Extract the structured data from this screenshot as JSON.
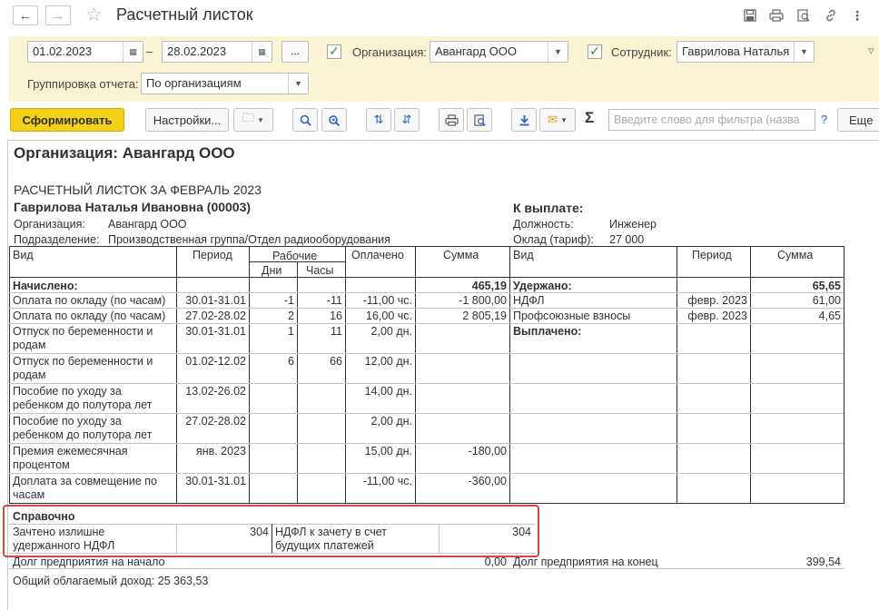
{
  "window": {
    "title": "Расчетный листок"
  },
  "params": {
    "date_from": "01.02.2023",
    "date_sep": "–",
    "date_to": "28.02.2023",
    "dots_label": "...",
    "org_label": "Организация:",
    "org_value": "Авангард ООО",
    "employee_label": "Сотрудник:",
    "employee_value": "Гаврилова Наталья И",
    "grouping_label": "Группировка отчета:",
    "grouping_value": "По организациям"
  },
  "toolbar": {
    "generate": "Сформировать",
    "settings": "Настройки...",
    "filter_placeholder": "Введите слово для фильтра (назва",
    "help": "?",
    "more": "Еще"
  },
  "report": {
    "org_header": "Организация: Авангард ООО",
    "sheet_title": "РАСЧЕТНЫЙ ЛИСТОК ЗА ФЕВРАЛЬ 2023",
    "employee_name": "Гаврилова Наталья Ивановна (00003)",
    "org_label": "Организация:",
    "org_value": "Авангард ООО",
    "dept_label": "Подразделение:",
    "dept_value": "Производственная группа/Отдел радиооборудования",
    "to_pay_label": "К выплате:",
    "position_label": "Должность:",
    "position_value": "Инженер",
    "salary_label": "Оклад (тариф):",
    "salary_value": "27 000",
    "left_headers": {
      "kind": "Вид",
      "period": "Период",
      "working": "Рабочие",
      "days": "Дни",
      "hours": "Часы",
      "paid": "Оплачено",
      "sum": "Сумма"
    },
    "right_headers": {
      "kind": "Вид",
      "period": "Период",
      "sum": "Сумма"
    },
    "accrued": {
      "label": "Начислено:",
      "total": "465,19",
      "rows": [
        {
          "kind": [
            "Оплата по окладу (по часам)"
          ],
          "period": "30.01-31.01",
          "days": "-1",
          "hours": "-11",
          "paid": "-11,00 чс.",
          "sum": "-1 800,00"
        },
        {
          "kind": [
            "Оплата по окладу (по часам)"
          ],
          "period": "27.02-28.02",
          "days": "2",
          "hours": "16",
          "paid": "16,00 чс.",
          "sum": "2 805,19"
        },
        {
          "kind": [
            "Отпуск по беременности и",
            "родам"
          ],
          "period": "30.01-31.01",
          "days": "1",
          "hours": "11",
          "paid": "2,00 дн.",
          "sum": ""
        },
        {
          "kind": [
            "Отпуск по беременности и",
            "родам"
          ],
          "period": "01.02-12.02",
          "days": "6",
          "hours": "66",
          "paid": "12,00 дн.",
          "sum": ""
        },
        {
          "kind": [
            "Пособие по уходу за",
            "ребенком до полутора лет"
          ],
          "period": "13.02-26.02",
          "days": "",
          "hours": "",
          "paid": "14,00 дн.",
          "sum": ""
        },
        {
          "kind": [
            "Пособие по уходу за",
            "ребенком до полутора лет"
          ],
          "period": "27.02-28.02",
          "days": "",
          "hours": "",
          "paid": "2,00 дн.",
          "sum": ""
        },
        {
          "kind": [
            "Премия ежемесячная",
            "процентом"
          ],
          "period": "янв. 2023",
          "days": "",
          "hours": "",
          "paid": "15,00 дн.",
          "sum": "-180,00"
        },
        {
          "kind": [
            "Доплата за совмещение по",
            "часам"
          ],
          "period": "30.01-31.01",
          "days": "",
          "hours": "",
          "paid": "-11,00 чс.",
          "sum": "-360,00"
        }
      ]
    },
    "withheld": {
      "label": "Удержано:",
      "total": "65,65",
      "rows": [
        {
          "kind": "НДФЛ",
          "period": "февр. 2023",
          "sum": "61,00"
        },
        {
          "kind": "Профсоюзные взносы",
          "period": "февр. 2023",
          "sum": "4,65"
        }
      ]
    },
    "paid_out_label": "Выплачено:",
    "reference": {
      "label": "Справочно",
      "left_label": [
        "Зачтено излишне",
        "удержанного НДФЛ"
      ],
      "left_value": "304",
      "right_label": [
        "НДФЛ к зачету в счет",
        "будущих платежей"
      ],
      "right_value": "304"
    },
    "debt_start_label": "Долг предприятия на начало",
    "debt_start_value": "0,00",
    "debt_end_label": "Долг предприятия на конец",
    "debt_end_value": "399,54",
    "taxable_income": "Общий облагаемый доход: 25 363,53"
  }
}
